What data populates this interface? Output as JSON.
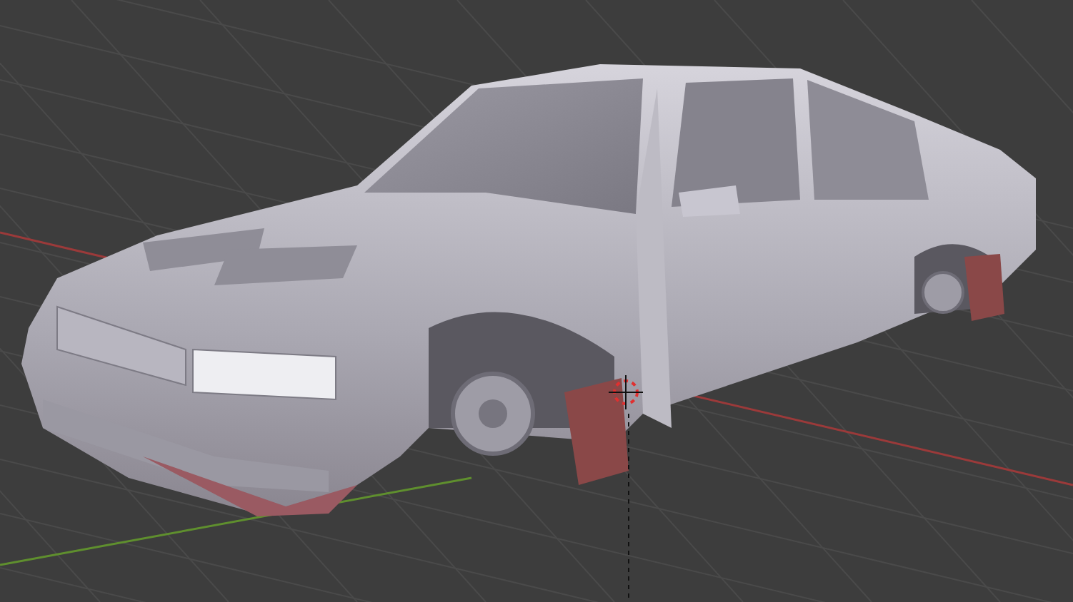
{
  "viewport": {
    "cursor": true
  }
}
